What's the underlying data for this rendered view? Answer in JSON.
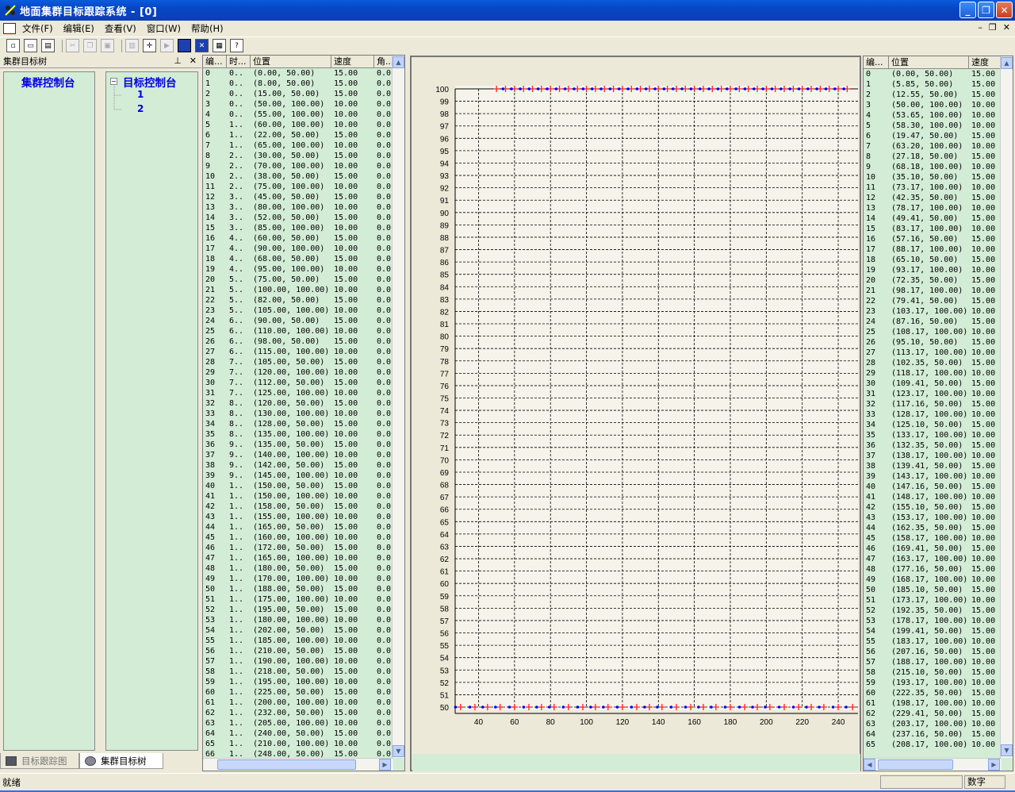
{
  "window": {
    "title": "地面集群目标跟踪系统 - [0]"
  },
  "menu": {
    "items": [
      "文件(F)",
      "编辑(E)",
      "查看(V)",
      "窗口(W)",
      "帮助(H)"
    ]
  },
  "tree_pane": {
    "title": "集群目标树",
    "root_left": "集群控制台",
    "root_right": "目标控制台",
    "children": [
      "1",
      "2"
    ],
    "tabs": [
      "目标跟踪图",
      "集群目标树"
    ]
  },
  "left_grid": {
    "headers": [
      "编...",
      "时...",
      "位置",
      "速度",
      "角..."
    ],
    "rows": [
      [
        "0",
        "0..",
        "(0.00, 50.00)",
        "15.00",
        "0.0"
      ],
      [
        "1",
        "0..",
        "(8.00, 50.00)",
        "15.00",
        "0.0"
      ],
      [
        "2",
        "0..",
        "(15.00, 50.00)",
        "15.00",
        "0.0"
      ],
      [
        "3",
        "0..",
        "(50.00, 100.00)",
        "10.00",
        "0.0"
      ],
      [
        "4",
        "0..",
        "(55.00, 100.00)",
        "10.00",
        "0.0"
      ],
      [
        "5",
        "1..",
        "(60.00, 100.00)",
        "10.00",
        "0.0"
      ],
      [
        "6",
        "1..",
        "(22.00, 50.00)",
        "15.00",
        "0.0"
      ],
      [
        "7",
        "1..",
        "(65.00, 100.00)",
        "10.00",
        "0.0"
      ],
      [
        "8",
        "2..",
        "(30.00, 50.00)",
        "15.00",
        "0.0"
      ],
      [
        "9",
        "2..",
        "(70.00, 100.00)",
        "10.00",
        "0.0"
      ],
      [
        "10",
        "2..",
        "(38.00, 50.00)",
        "15.00",
        "0.0"
      ],
      [
        "11",
        "2..",
        "(75.00, 100.00)",
        "10.00",
        "0.0"
      ],
      [
        "12",
        "3..",
        "(45.00, 50.00)",
        "15.00",
        "0.0"
      ],
      [
        "13",
        "3..",
        "(80.00, 100.00)",
        "10.00",
        "0.0"
      ],
      [
        "14",
        "3..",
        "(52.00, 50.00)",
        "15.00",
        "0.0"
      ],
      [
        "15",
        "3..",
        "(85.00, 100.00)",
        "10.00",
        "0.0"
      ],
      [
        "16",
        "4..",
        "(60.00, 50.00)",
        "15.00",
        "0.0"
      ],
      [
        "17",
        "4..",
        "(90.00, 100.00)",
        "10.00",
        "0.0"
      ],
      [
        "18",
        "4..",
        "(68.00, 50.00)",
        "15.00",
        "0.0"
      ],
      [
        "19",
        "4..",
        "(95.00, 100.00)",
        "10.00",
        "0.0"
      ],
      [
        "20",
        "5..",
        "(75.00, 50.00)",
        "15.00",
        "0.0"
      ],
      [
        "21",
        "5..",
        "(100.00, 100.00)",
        "10.00",
        "0.0"
      ],
      [
        "22",
        "5..",
        "(82.00, 50.00)",
        "15.00",
        "0.0"
      ],
      [
        "23",
        "5..",
        "(105.00, 100.00)",
        "10.00",
        "0.0"
      ],
      [
        "24",
        "6..",
        "(90.00, 50.00)",
        "15.00",
        "0.0"
      ],
      [
        "25",
        "6..",
        "(110.00, 100.00)",
        "10.00",
        "0.0"
      ],
      [
        "26",
        "6..",
        "(98.00, 50.00)",
        "15.00",
        "0.0"
      ],
      [
        "27",
        "6..",
        "(115.00, 100.00)",
        "10.00",
        "0.0"
      ],
      [
        "28",
        "7..",
        "(105.00, 50.00)",
        "15.00",
        "0.0"
      ],
      [
        "29",
        "7..",
        "(120.00, 100.00)",
        "10.00",
        "0.0"
      ],
      [
        "30",
        "7..",
        "(112.00, 50.00)",
        "15.00",
        "0.0"
      ],
      [
        "31",
        "7..",
        "(125.00, 100.00)",
        "10.00",
        "0.0"
      ],
      [
        "32",
        "8..",
        "(120.00, 50.00)",
        "15.00",
        "0.0"
      ],
      [
        "33",
        "8..",
        "(130.00, 100.00)",
        "10.00",
        "0.0"
      ],
      [
        "34",
        "8..",
        "(128.00, 50.00)",
        "15.00",
        "0.0"
      ],
      [
        "35",
        "8..",
        "(135.00, 100.00)",
        "10.00",
        "0.0"
      ],
      [
        "36",
        "9..",
        "(135.00, 50.00)",
        "15.00",
        "0.0"
      ],
      [
        "37",
        "9..",
        "(140.00, 100.00)",
        "10.00",
        "0.0"
      ],
      [
        "38",
        "9..",
        "(142.00, 50.00)",
        "15.00",
        "0.0"
      ],
      [
        "39",
        "9..",
        "(145.00, 100.00)",
        "10.00",
        "0.0"
      ],
      [
        "40",
        "1..",
        "(150.00, 50.00)",
        "15.00",
        "0.0"
      ],
      [
        "41",
        "1..",
        "(150.00, 100.00)",
        "10.00",
        "0.0"
      ],
      [
        "42",
        "1..",
        "(158.00, 50.00)",
        "15.00",
        "0.0"
      ],
      [
        "43",
        "1..",
        "(155.00, 100.00)",
        "10.00",
        "0.0"
      ],
      [
        "44",
        "1..",
        "(165.00, 50.00)",
        "15.00",
        "0.0"
      ],
      [
        "45",
        "1..",
        "(160.00, 100.00)",
        "10.00",
        "0.0"
      ],
      [
        "46",
        "1..",
        "(172.00, 50.00)",
        "15.00",
        "0.0"
      ],
      [
        "47",
        "1..",
        "(165.00, 100.00)",
        "10.00",
        "0.0"
      ],
      [
        "48",
        "1..",
        "(180.00, 50.00)",
        "15.00",
        "0.0"
      ],
      [
        "49",
        "1..",
        "(170.00, 100.00)",
        "10.00",
        "0.0"
      ],
      [
        "50",
        "1..",
        "(188.00, 50.00)",
        "15.00",
        "0.0"
      ],
      [
        "51",
        "1..",
        "(175.00, 100.00)",
        "10.00",
        "0.0"
      ],
      [
        "52",
        "1..",
        "(195.00, 50.00)",
        "15.00",
        "0.0"
      ],
      [
        "53",
        "1..",
        "(180.00, 100.00)",
        "10.00",
        "0.0"
      ],
      [
        "54",
        "1..",
        "(202.00, 50.00)",
        "15.00",
        "0.0"
      ],
      [
        "55",
        "1..",
        "(185.00, 100.00)",
        "10.00",
        "0.0"
      ],
      [
        "56",
        "1..",
        "(210.00, 50.00)",
        "15.00",
        "0.0"
      ],
      [
        "57",
        "1..",
        "(190.00, 100.00)",
        "10.00",
        "0.0"
      ],
      [
        "58",
        "1..",
        "(218.00, 50.00)",
        "15.00",
        "0.0"
      ],
      [
        "59",
        "1..",
        "(195.00, 100.00)",
        "10.00",
        "0.0"
      ],
      [
        "60",
        "1..",
        "(225.00, 50.00)",
        "15.00",
        "0.0"
      ],
      [
        "61",
        "1..",
        "(200.00, 100.00)",
        "10.00",
        "0.0"
      ],
      [
        "62",
        "1..",
        "(232.00, 50.00)",
        "15.00",
        "0.0"
      ],
      [
        "63",
        "1..",
        "(205.00, 100.00)",
        "10.00",
        "0.0"
      ],
      [
        "64",
        "1..",
        "(240.00, 50.00)",
        "15.00",
        "0.0"
      ],
      [
        "65",
        "1..",
        "(210.00, 100.00)",
        "10.00",
        "0.0"
      ],
      [
        "66",
        "1..",
        "(248.00, 50.00)",
        "15.00",
        "0.0"
      ]
    ]
  },
  "right_grid": {
    "headers": [
      "编...",
      "位置",
      "速度"
    ],
    "rows": [
      [
        "0",
        "(0.00, 50.00)",
        "15.00"
      ],
      [
        "1",
        "(5.85, 50.00)",
        "15.00"
      ],
      [
        "2",
        "(12.55, 50.00)",
        "15.00"
      ],
      [
        "3",
        "(50.00, 100.00)",
        "10.00"
      ],
      [
        "4",
        "(53.65, 100.00)",
        "10.00"
      ],
      [
        "5",
        "(58.30, 100.00)",
        "10.00"
      ],
      [
        "6",
        "(19.47, 50.00)",
        "15.00"
      ],
      [
        "7",
        "(63.20, 100.00)",
        "10.00"
      ],
      [
        "8",
        "(27.18, 50.00)",
        "15.00"
      ],
      [
        "9",
        "(68.18, 100.00)",
        "10.00"
      ],
      [
        "10",
        "(35.10, 50.00)",
        "15.00"
      ],
      [
        "11",
        "(73.17, 100.00)",
        "10.00"
      ],
      [
        "12",
        "(42.35, 50.00)",
        "15.00"
      ],
      [
        "13",
        "(78.17, 100.00)",
        "10.00"
      ],
      [
        "14",
        "(49.41, 50.00)",
        "15.00"
      ],
      [
        "15",
        "(83.17, 100.00)",
        "10.00"
      ],
      [
        "16",
        "(57.16, 50.00)",
        "15.00"
      ],
      [
        "17",
        "(88.17, 100.00)",
        "10.00"
      ],
      [
        "18",
        "(65.10, 50.00)",
        "15.00"
      ],
      [
        "19",
        "(93.17, 100.00)",
        "10.00"
      ],
      [
        "20",
        "(72.35, 50.00)",
        "15.00"
      ],
      [
        "21",
        "(98.17, 100.00)",
        "10.00"
      ],
      [
        "22",
        "(79.41, 50.00)",
        "15.00"
      ],
      [
        "23",
        "(103.17, 100.00)",
        "10.00"
      ],
      [
        "24",
        "(87.16, 50.00)",
        "15.00"
      ],
      [
        "25",
        "(108.17, 100.00)",
        "10.00"
      ],
      [
        "26",
        "(95.10, 50.00)",
        "15.00"
      ],
      [
        "27",
        "(113.17, 100.00)",
        "10.00"
      ],
      [
        "28",
        "(102.35, 50.00)",
        "15.00"
      ],
      [
        "29",
        "(118.17, 100.00)",
        "10.00"
      ],
      [
        "30",
        "(109.41, 50.00)",
        "15.00"
      ],
      [
        "31",
        "(123.17, 100.00)",
        "10.00"
      ],
      [
        "32",
        "(117.16, 50.00)",
        "15.00"
      ],
      [
        "33",
        "(128.17, 100.00)",
        "10.00"
      ],
      [
        "34",
        "(125.10, 50.00)",
        "15.00"
      ],
      [
        "35",
        "(133.17, 100.00)",
        "10.00"
      ],
      [
        "36",
        "(132.35, 50.00)",
        "15.00"
      ],
      [
        "37",
        "(138.17, 100.00)",
        "10.00"
      ],
      [
        "38",
        "(139.41, 50.00)",
        "15.00"
      ],
      [
        "39",
        "(143.17, 100.00)",
        "10.00"
      ],
      [
        "40",
        "(147.16, 50.00)",
        "15.00"
      ],
      [
        "41",
        "(148.17, 100.00)",
        "10.00"
      ],
      [
        "42",
        "(155.10, 50.00)",
        "15.00"
      ],
      [
        "43",
        "(153.17, 100.00)",
        "10.00"
      ],
      [
        "44",
        "(162.35, 50.00)",
        "15.00"
      ],
      [
        "45",
        "(158.17, 100.00)",
        "10.00"
      ],
      [
        "46",
        "(169.41, 50.00)",
        "15.00"
      ],
      [
        "47",
        "(163.17, 100.00)",
        "10.00"
      ],
      [
        "48",
        "(177.16, 50.00)",
        "15.00"
      ],
      [
        "49",
        "(168.17, 100.00)",
        "10.00"
      ],
      [
        "50",
        "(185.10, 50.00)",
        "15.00"
      ],
      [
        "51",
        "(173.17, 100.00)",
        "10.00"
      ],
      [
        "52",
        "(192.35, 50.00)",
        "15.00"
      ],
      [
        "53",
        "(178.17, 100.00)",
        "10.00"
      ],
      [
        "54",
        "(199.41, 50.00)",
        "15.00"
      ],
      [
        "55",
        "(183.17, 100.00)",
        "10.00"
      ],
      [
        "56",
        "(207.16, 50.00)",
        "15.00"
      ],
      [
        "57",
        "(188.17, 100.00)",
        "10.00"
      ],
      [
        "58",
        "(215.10, 50.00)",
        "15.00"
      ],
      [
        "59",
        "(193.17, 100.00)",
        "10.00"
      ],
      [
        "60",
        "(222.35, 50.00)",
        "15.00"
      ],
      [
        "61",
        "(198.17, 100.00)",
        "10.00"
      ],
      [
        "62",
        "(229.41, 50.00)",
        "15.00"
      ],
      [
        "63",
        "(203.17, 100.00)",
        "10.00"
      ],
      [
        "64",
        "(237.16, 50.00)",
        "15.00"
      ],
      [
        "65",
        "(208.17, 100.00)",
        "10.00"
      ]
    ]
  },
  "chart_data": {
    "type": "scatter",
    "title": "",
    "xlabel": "",
    "ylabel": "",
    "xlim": [
      27,
      251
    ],
    "ylim": [
      50,
      100
    ],
    "xticks": [
      40,
      60,
      80,
      100,
      120,
      140,
      160,
      180,
      200,
      220,
      240
    ],
    "yticks": [
      50,
      51,
      52,
      53,
      54,
      55,
      56,
      57,
      58,
      59,
      60,
      61,
      62,
      63,
      64,
      65,
      66,
      67,
      68,
      69,
      70,
      71,
      72,
      73,
      74,
      75,
      76,
      77,
      78,
      79,
      80,
      81,
      82,
      83,
      84,
      85,
      86,
      87,
      88,
      89,
      90,
      91,
      92,
      93,
      94,
      95,
      96,
      97,
      98,
      99,
      100
    ],
    "grid": true,
    "colors": {
      "measurement": "#ff2020",
      "track": "#0000ff",
      "grid": "#000000",
      "background": "#f5f3ea"
    },
    "series": [
      {
        "marker": "plus",
        "y": 100,
        "x": [
          50,
          55,
          60,
          65,
          70,
          75,
          80,
          85,
          90,
          95,
          100,
          105,
          110,
          115,
          120,
          125,
          130,
          135,
          140,
          145,
          150,
          155,
          160,
          165,
          170,
          175,
          180,
          185,
          190,
          195,
          200,
          205,
          210,
          215,
          220,
          225,
          230,
          235,
          240,
          245
        ]
      },
      {
        "marker": "dot",
        "y": 100,
        "x": [
          53.65,
          58.3,
          63.2,
          68.18,
          73.17,
          78.17,
          83.17,
          88.17,
          93.17,
          98.17,
          103.17,
          108.17,
          113.17,
          118.17,
          123.17,
          128.17,
          133.17,
          138.17,
          143.17,
          148.17,
          153.17,
          158.17,
          163.17,
          168.17,
          173.17,
          178.17,
          183.17,
          188.17,
          193.17,
          198.17,
          203.17,
          208.17,
          213.17,
          218.17,
          223.17,
          228.17,
          233.17,
          238.17,
          243.17
        ]
      },
      {
        "marker": "plus",
        "y": 50,
        "x": [
          30,
          38,
          45,
          52,
          60,
          68,
          75,
          82,
          90,
          98,
          105,
          112,
          120,
          128,
          135,
          142,
          150,
          158,
          165,
          172,
          180,
          188,
          195,
          202,
          210,
          218,
          225,
          232,
          240,
          248
        ]
      },
      {
        "marker": "dot",
        "y": 50,
        "x": [
          27.18,
          35.1,
          42.35,
          49.41,
          57.16,
          65.1,
          72.35,
          79.41,
          87.16,
          95.1,
          102.35,
          109.41,
          117.16,
          125.1,
          132.35,
          139.41,
          147.16,
          155.1,
          162.35,
          169.41,
          177.16,
          185.1,
          192.35,
          199.41,
          207.16,
          215.1,
          222.35,
          229.41,
          237.16,
          244.41
        ]
      }
    ]
  },
  "status": {
    "text": "就绪",
    "indicator": "数字"
  }
}
